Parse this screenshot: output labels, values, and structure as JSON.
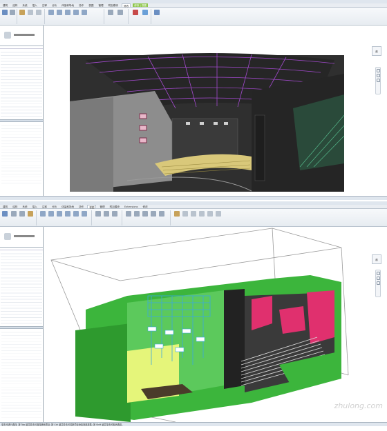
{
  "screenshot1": {
    "tabs": [
      "建筑",
      "结构",
      "系统",
      "插入",
      "注释",
      "分析",
      "体量和场地",
      "协作",
      "视图",
      "管理",
      "附加模块",
      "修改",
      "修改 | 视图"
    ],
    "view_cube_label": "前",
    "status": ""
  },
  "screenshot2": {
    "tabs": [
      "建筑",
      "结构",
      "系统",
      "插入",
      "注释",
      "分析",
      "体量和场地",
      "协作",
      "视图",
      "管理",
      "附加模块",
      "Extensions",
      "修改"
    ],
    "view_cube_label": "前",
    "status": "单击可进行选择; 按 Tab 键并单击可选择其他项目; 按 Ctrl 键并单击可将新项目添加到选择集; 按 Shift 键并单击可取消选择。"
  },
  "watermark": "zhulong.com",
  "colors": {
    "accent": "#8ec64a",
    "green_model": "#3cb53c",
    "magenta_seats": "#e0306e",
    "cyan_grid": "#3aa9e0"
  }
}
